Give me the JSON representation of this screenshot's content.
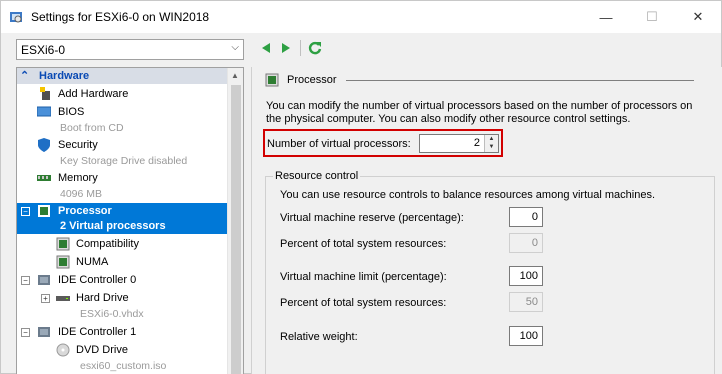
{
  "window": {
    "title": "Settings for ESXi6-0 on WIN2018",
    "minimize_glyph": "—",
    "maximize_glyph": "☐",
    "close_glyph": "✕"
  },
  "vm_selector": {
    "value": "ESXi6-0",
    "arrow": "⌵"
  },
  "toolbar": {
    "back_glyph": "◀",
    "forward_glyph": "▶",
    "refresh_glyph": "↻"
  },
  "tree": {
    "section_chevron": "⌃",
    "section_label": "Hardware",
    "items": [
      {
        "label": "Add Hardware"
      },
      {
        "label": "BIOS",
        "sub": "Boot from CD"
      },
      {
        "label": "Security",
        "sub": "Key Storage Drive disabled"
      },
      {
        "label": "Memory",
        "sub": "4096 MB"
      },
      {
        "label": "Processor",
        "sub": "2 Virtual processors",
        "expander": "−"
      },
      {
        "label": "Compatibility"
      },
      {
        "label": "NUMA"
      },
      {
        "label": "IDE Controller 0",
        "expander": "−"
      },
      {
        "label": "Hard Drive",
        "sub": "ESXi6-0.vhdx",
        "expander": "+"
      },
      {
        "label": "IDE Controller 1",
        "expander": "−"
      },
      {
        "label": "DVD Drive",
        "sub": "esxi60_custom.iso"
      }
    ]
  },
  "processor": {
    "title": "Processor",
    "description": "You can modify the number of virtual processors based on the number of processors on the physical computer. You can also modify other resource control settings.",
    "num_vp_label": "Number of virtual processors:",
    "num_vp_value": "2",
    "spin_up": "▲",
    "spin_down": "▼"
  },
  "resource_control": {
    "title": "Resource control",
    "description": "You can use resource controls to balance resources among virtual machines.",
    "fields": [
      {
        "label": "Virtual machine reserve (percentage):",
        "value": "0",
        "enabled": true
      },
      {
        "label": "Percent of total system resources:",
        "value": "0",
        "enabled": false
      },
      {
        "label": "Virtual machine limit (percentage):",
        "value": "100",
        "enabled": true
      },
      {
        "label": "Percent of total system resources:",
        "value": "50",
        "enabled": false
      },
      {
        "label": "Relative weight:",
        "value": "100",
        "enabled": true
      }
    ]
  },
  "colors": {
    "accent": "#0078d7",
    "highlight_border": "#d20000",
    "section_header": "#0a4ab4"
  }
}
